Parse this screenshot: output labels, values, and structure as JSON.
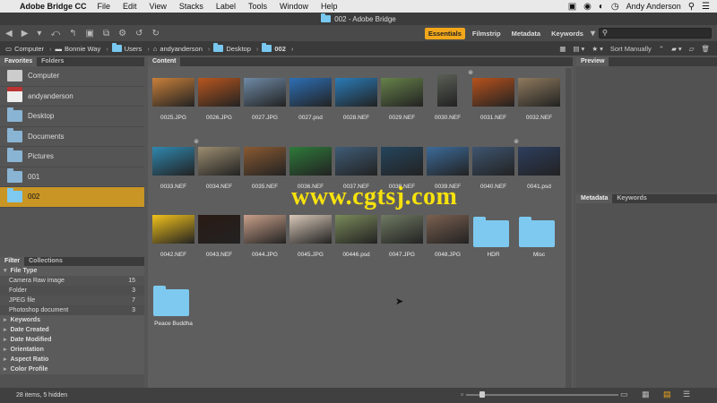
{
  "menubar": {
    "app_name": "Adobe Bridge CC",
    "items": [
      "File",
      "Edit",
      "View",
      "Stacks",
      "Label",
      "Tools",
      "Window",
      "Help"
    ],
    "user": "Andy Anderson"
  },
  "window": {
    "title": "002 - Adobe Bridge"
  },
  "toolbar": {
    "workspaces": [
      "Essentials",
      "Filmstrip",
      "Metadata",
      "Keywords"
    ],
    "active_workspace": "Essentials",
    "search_placeholder": "",
    "accent": "#f2a71b"
  },
  "pathbar": {
    "crumbs": [
      "Computer",
      "Bonnie Way",
      "Users",
      "andyanderson",
      "Desktop",
      "002"
    ],
    "sort_label": "Sort Manually"
  },
  "favorites": {
    "tabs": [
      "Favorites",
      "Folders"
    ],
    "items": [
      "Computer",
      "andyanderson",
      "Desktop",
      "Documents",
      "Pictures",
      "001",
      "002"
    ],
    "selected": "002"
  },
  "filter": {
    "tabs": [
      "Filter",
      "Collections"
    ],
    "file_type_header": "File Type",
    "file_types": [
      {
        "name": "Camera Raw image",
        "count": "15"
      },
      {
        "name": "Folder",
        "count": "3"
      },
      {
        "name": "JPEG file",
        "count": "7"
      },
      {
        "name": "Photoshop document",
        "count": "3"
      }
    ],
    "sections": [
      "Keywords",
      "Date Created",
      "Date Modified",
      "Orientation",
      "Aspect Ratio",
      "Color Profile"
    ]
  },
  "content": {
    "tab": "Content",
    "items": [
      {
        "name": "0025.JPG",
        "color": "#c9803a"
      },
      {
        "name": "0026.JPG",
        "color": "#b8561e"
      },
      {
        "name": "0027.JPG",
        "color": "#6f8aa6"
      },
      {
        "name": "0027.psd",
        "color": "#2d6fb6"
      },
      {
        "name": "0028.NEF",
        "color": "#2a7bb8"
      },
      {
        "name": "0029.NEF",
        "color": "#67824a"
      },
      {
        "name": "0030.NEF",
        "color": "#5a5f55"
      },
      {
        "name": "0031.NEF",
        "color": "#b8521c"
      },
      {
        "name": "0032.NEF",
        "color": "#8f7a5e"
      },
      {
        "name": "0033.NEF",
        "color": "#2f88b0"
      },
      {
        "name": "0034.NEF",
        "color": "#9c8d70"
      },
      {
        "name": "0035.NEF",
        "color": "#8a5a32"
      },
      {
        "name": "0036.NEF",
        "color": "#2e7a3a"
      },
      {
        "name": "0037.NEF",
        "color": "#3f5c76"
      },
      {
        "name": "0038.NEF",
        "color": "#25455d"
      },
      {
        "name": "0039.NEF",
        "color": "#3c6b9a"
      },
      {
        "name": "0040.NEF",
        "color": "#3e5570"
      },
      {
        "name": "0041.psd",
        "color": "#2d3e5e"
      },
      {
        "name": "0042.NEF",
        "color": "#f2c21b"
      },
      {
        "name": "0043.NEF",
        "color": "#2a1a14"
      },
      {
        "name": "0044.JPG",
        "color": "#c9a08a"
      },
      {
        "name": "0045.JPG",
        "color": "#d8c8b8"
      },
      {
        "name": "00446.psd",
        "color": "#7a8a5a"
      },
      {
        "name": "0047.JPG",
        "color": "#6f7a62"
      },
      {
        "name": "0048.JPG",
        "color": "#7b6050"
      },
      {
        "name": "HDR",
        "color": "#7ec9ef"
      },
      {
        "name": "Misc",
        "color": "#7ec9ef"
      },
      {
        "name": "Peace Buddha",
        "color": "#7ec9ef"
      }
    ]
  },
  "right_panels": {
    "preview_tab": "Preview",
    "metadata_tabs": [
      "Metadata",
      "Keywords"
    ]
  },
  "status": {
    "text": "28 items, 5 hidden"
  },
  "watermark": "www.cgtsj.com"
}
